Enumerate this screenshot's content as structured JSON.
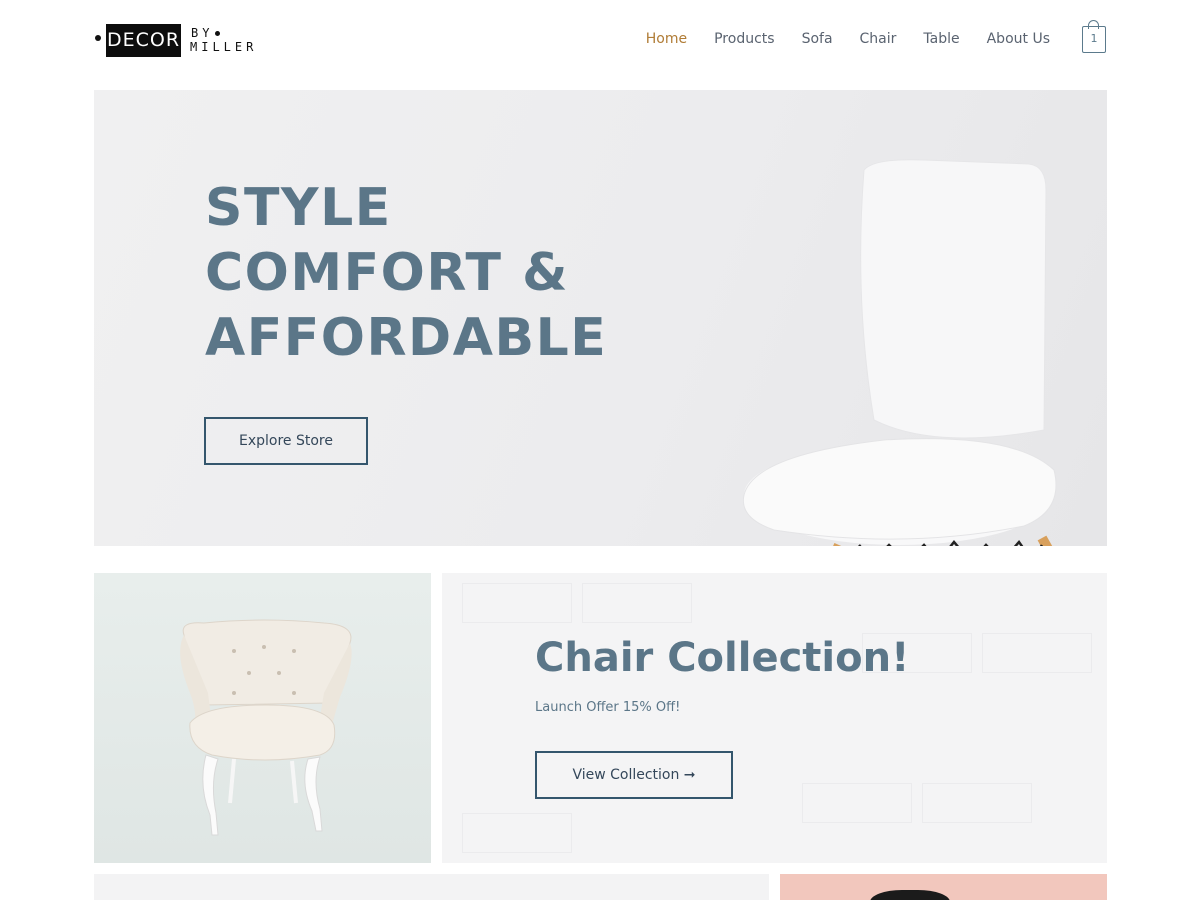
{
  "brand": {
    "logo_main": "DECOR",
    "logo_by": "BY",
    "logo_name": "MILLER"
  },
  "nav": {
    "items": [
      {
        "label": "Home",
        "active": true
      },
      {
        "label": "Products",
        "active": false
      },
      {
        "label": "Sofa",
        "active": false
      },
      {
        "label": "Chair",
        "active": false
      },
      {
        "label": "Table",
        "active": false
      },
      {
        "label": "About Us",
        "active": false
      }
    ]
  },
  "cart": {
    "count": "1",
    "icon": "shopping-bag-icon"
  },
  "hero": {
    "title_lines": [
      "STYLE",
      "COMFORT &",
      "AFFORDABLE"
    ],
    "button_label": "Explore Store",
    "image": "white-chair-wooden-legs"
  },
  "collection": {
    "image": "tufted-cream-armchair",
    "title": "Chair Collection!",
    "subtitle": "Launch Offer 15% Off!",
    "button_label": "View Collection ➞"
  },
  "colors": {
    "accent": "#b07c36",
    "heading": "#5b7688",
    "button_border": "#34566d"
  }
}
